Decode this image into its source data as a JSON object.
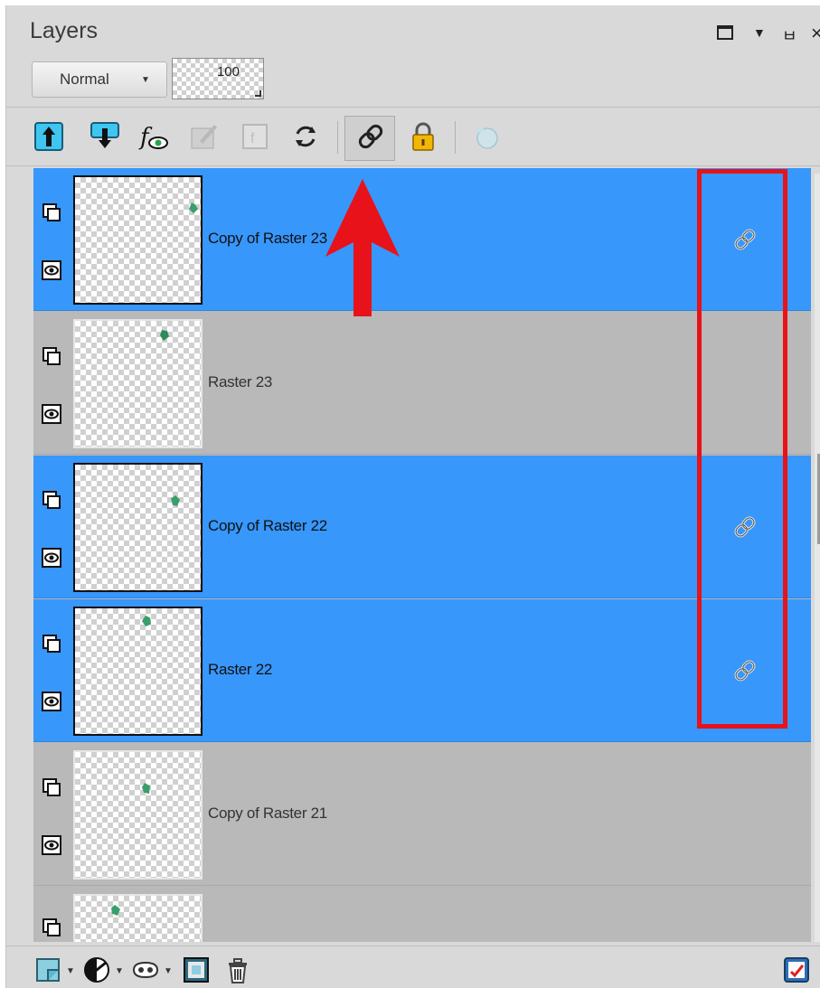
{
  "panel": {
    "title": "Layers",
    "blend_mode": "Normal",
    "opacity": "100"
  },
  "toolbar": {
    "icons": [
      "move-up-icon",
      "move-down-icon",
      "layer-effects-icon",
      "layer-properties-icon",
      "mask-icon",
      "refresh-icon",
      "link-icon",
      "lock-icon",
      "palette-icon"
    ]
  },
  "layers": [
    {
      "name": "Copy of Raster 23",
      "selected": true,
      "linked": true
    },
    {
      "name": "Raster 23",
      "selected": false,
      "linked": false
    },
    {
      "name": "Copy of Raster 22",
      "selected": true,
      "linked": true
    },
    {
      "name": "Raster 22",
      "selected": true,
      "linked": true
    },
    {
      "name": "Copy of Raster 21",
      "selected": false,
      "linked": false
    },
    {
      "name": "",
      "selected": false,
      "linked": false
    }
  ],
  "colors": {
    "selected_row": "#3797fb",
    "unselected_row": "#b9b9b9",
    "annotation_red": "#e8121a"
  }
}
